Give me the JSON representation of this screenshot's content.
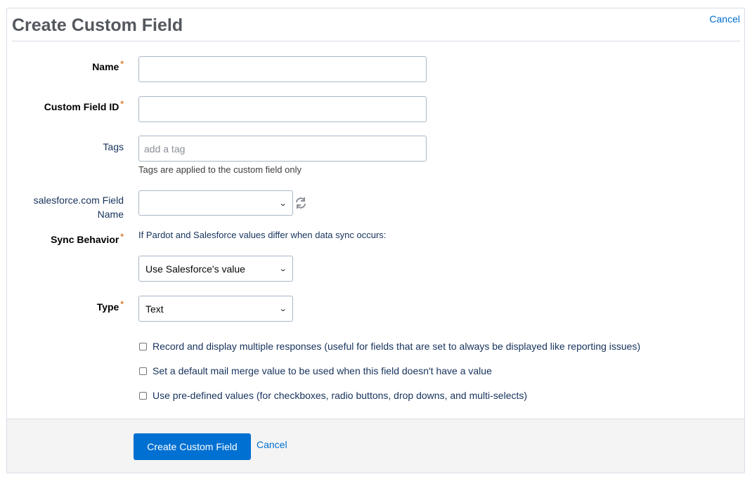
{
  "header": {
    "title": "Create Custom Field",
    "cancel_label": "Cancel"
  },
  "fields": {
    "name": {
      "label": "Name",
      "required_mark": "*",
      "value": ""
    },
    "custom_field_id": {
      "label": "Custom Field ID",
      "required_mark": "*",
      "value": ""
    },
    "tags": {
      "label": "Tags",
      "placeholder": "add a tag",
      "helper": "Tags are applied to the custom field only"
    },
    "salesforce_field": {
      "label_line1": "salesforce.com Field",
      "label_line2": "Name",
      "selected": ""
    },
    "sync_behavior": {
      "label": "Sync Behavior",
      "required_mark": "*",
      "description": "If Pardot and Salesforce values differ when data sync occurs:",
      "selected": "Use Salesforce's value"
    },
    "type": {
      "label": "Type",
      "required_mark": "*",
      "selected": "Text"
    }
  },
  "options": [
    {
      "label": "Record and display multiple responses (useful for fields that are set to always be displayed like reporting issues)",
      "checked": false
    },
    {
      "label": "Set a default mail merge value to be used when this field doesn't have a value",
      "checked": false
    },
    {
      "label": "Use pre-defined values (for checkboxes, radio buttons, drop downs, and multi-selects)",
      "checked": false
    }
  ],
  "footer": {
    "submit_label": "Create Custom Field",
    "cancel_label": "Cancel"
  },
  "colors": {
    "primary": "#0070d2",
    "required": "#e07b2a",
    "footer_bg": "#f4f4f4"
  },
  "icons": {
    "refresh": "refresh-icon",
    "dropdown": "chevron-down-icon"
  }
}
